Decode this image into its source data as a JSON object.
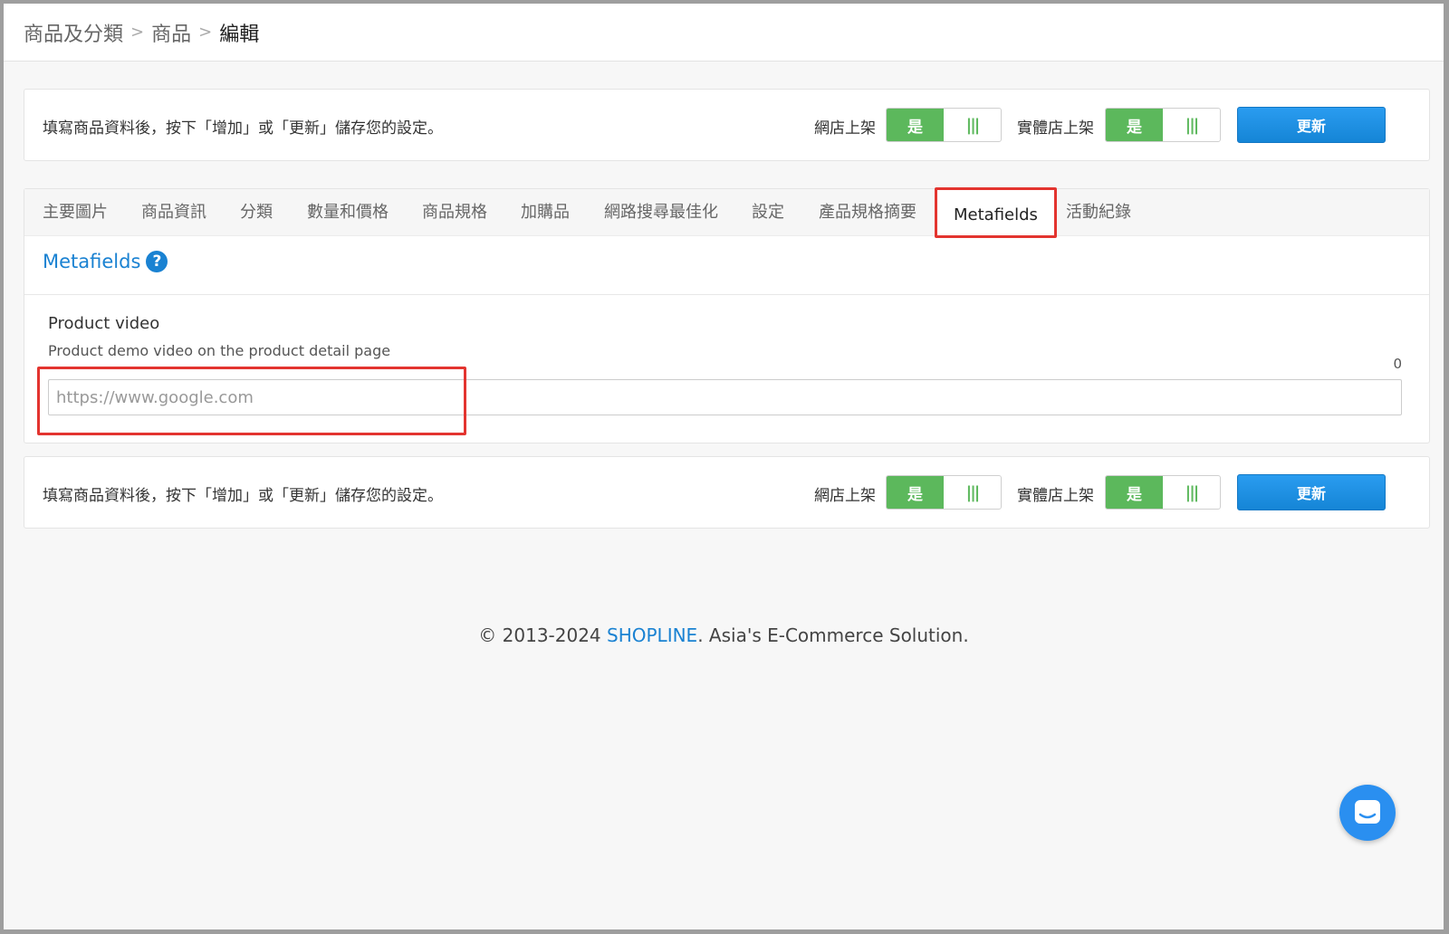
{
  "breadcrumb": {
    "items": [
      "商品及分類",
      "商品"
    ],
    "current": "編輯",
    "separator": ">"
  },
  "savebar": {
    "hint": "填寫商品資料後，按下「增加」或「更新」儲存您的設定。",
    "online_label": "網店上架",
    "retail_label": "實體店上架",
    "toggle_on": "是",
    "toggle_grip": "|||",
    "update_label": "更新"
  },
  "tabs": [
    {
      "label": "主要圖片"
    },
    {
      "label": "商品資訊"
    },
    {
      "label": "分類"
    },
    {
      "label": "數量和價格"
    },
    {
      "label": "商品規格"
    },
    {
      "label": "加購品"
    },
    {
      "label": "網路搜尋最佳化"
    },
    {
      "label": "設定"
    },
    {
      "label": "產品規格摘要"
    },
    {
      "label": "Metafields",
      "active": true
    },
    {
      "label": "活動紀錄"
    }
  ],
  "section": {
    "title": "Metafields",
    "help": "?"
  },
  "field": {
    "label": "Product video",
    "description": "Product demo video on the product detail page",
    "char_count": "0",
    "placeholder": "https://www.google.com",
    "value": ""
  },
  "footer": {
    "prefix": "© 2013-2024 ",
    "brand": "SHOPLINE",
    "suffix": ". Asia's E-Commerce Solution."
  },
  "colors": {
    "accent": "#1a82d2",
    "toggle_on": "#5cb85c",
    "highlight": "#e3342f",
    "button": "#1585d6"
  },
  "icons": {
    "help": "question-circle-icon",
    "chat": "chat-icon"
  }
}
